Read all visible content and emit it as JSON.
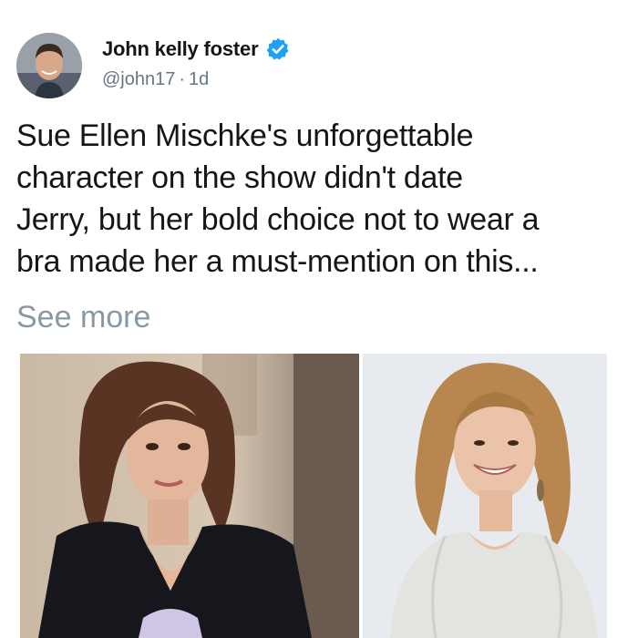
{
  "author": {
    "display_name": "John kelly foster",
    "handle": "@john17",
    "separator": "·",
    "timestamp": "1d",
    "verified": true,
    "avatar_icon": "avatar-photo"
  },
  "tweet": {
    "text_lines": [
      "Sue Ellen Mischke's unforgettable",
      "character on the show didn't date",
      "Jerry, but her bold choice not to wear a",
      "bra made her a must-mention on this..."
    ],
    "see_more_label": "See more"
  },
  "media": {
    "photos": [
      {
        "name": "photo-left",
        "description_icon": "tv-still-photo"
      },
      {
        "name": "photo-right",
        "description_icon": "portrait-photo"
      }
    ]
  },
  "colors": {
    "text_primary": "#14171a",
    "text_secondary": "#657786",
    "see_more": "#8899a6",
    "verified_blue": "#1da1f2"
  }
}
